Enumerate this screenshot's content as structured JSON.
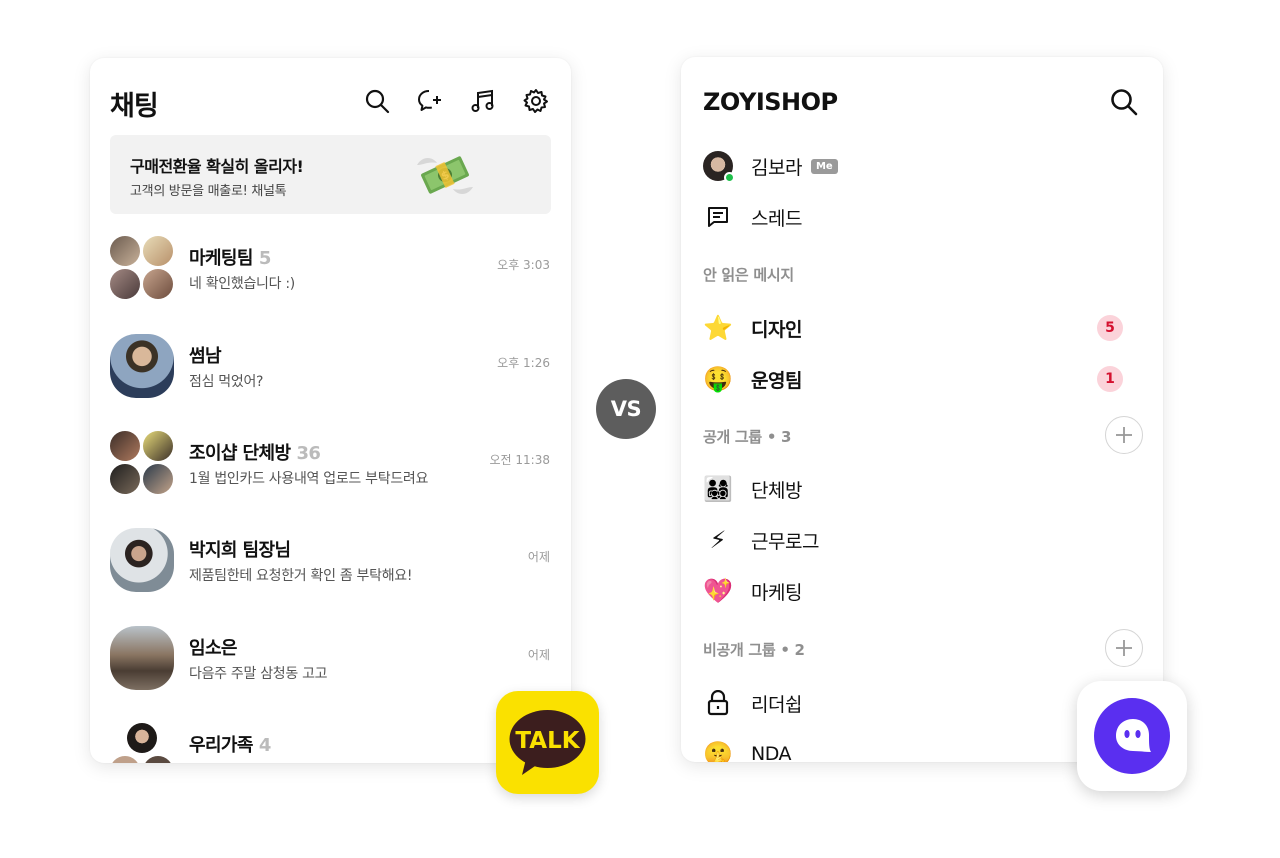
{
  "kakao": {
    "title": "채팅",
    "icons": [
      "search-icon",
      "new-chat-icon",
      "music-icon",
      "settings-icon"
    ],
    "banner": {
      "title": "구매전환율 확실히 올리자!",
      "subtitle": "고객의 방문을 매출로! 채널톡",
      "icon": "money-with-wings-icon"
    },
    "chats": [
      {
        "name": "마케팅팀",
        "count": "5",
        "message": "네 확인했습니다 :)",
        "time": "오후 3:03"
      },
      {
        "name": "썸남",
        "count": "",
        "message": "점심 먹었어?",
        "time": "오후 1:26"
      },
      {
        "name": "조이샵 단체방",
        "count": "36",
        "message": "1월 법인카드 사용내역 업로드 부탁드려요",
        "time": "오전 11:38"
      },
      {
        "name": "박지희 팀장님",
        "count": "",
        "message": "제품팀한테 요청한거 확인 좀 부탁해요!",
        "time": "어제"
      },
      {
        "name": "임소은",
        "count": "",
        "message": "다음주 주말 삼청동 고고",
        "time": "어제"
      },
      {
        "name": "우리가족",
        "count": "4",
        "message": "",
        "time": ""
      }
    ],
    "logo_text": "TALK",
    "logo_color": "#FAE100"
  },
  "vs": "VS",
  "channel": {
    "workspace": "ZOYISHOP",
    "me": {
      "name": "김보라",
      "badge": "Me"
    },
    "threads": "스레드",
    "unread_header": "안 읽은 메시지",
    "unread": [
      {
        "icon": "⭐",
        "label": "디자인",
        "badge": "5"
      },
      {
        "icon": "🤑",
        "label": "운영팀",
        "badge": "1"
      }
    ],
    "public_header": "공개 그룹 • 3",
    "public": [
      {
        "icon": "👨‍👩‍👧‍👦",
        "label": "단체방"
      },
      {
        "icon": "⚡",
        "label": "근무로그"
      },
      {
        "icon": "💖",
        "label": "마케팅"
      }
    ],
    "private_header": "비공개 그룹 • 2",
    "private": [
      {
        "icon": "lock-icon",
        "label": "리더쉽"
      },
      {
        "icon": "🤫",
        "label": "NDA"
      }
    ],
    "accent": "#5A2FF0",
    "badge_color": "#D4102F"
  }
}
